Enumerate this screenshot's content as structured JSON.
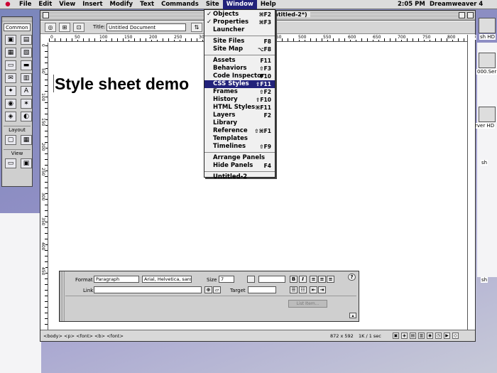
{
  "menubar": {
    "items": [
      "File",
      "Edit",
      "View",
      "Insert",
      "Modify",
      "Text",
      "Commands",
      "Site",
      "Window",
      "Help"
    ],
    "active": "Window",
    "clock": "2:05 PM",
    "app_name": "Dreamweaver 4"
  },
  "desktop": {
    "labels": [
      "000.Ser",
      "sh HD",
      "rver HD",
      "sh",
      "sh"
    ]
  },
  "objects_panel": {
    "select_value": "Common",
    "section_layout": "Layout",
    "section_view": "View"
  },
  "document": {
    "window_title_fragment": "ntitled-2*)",
    "title_label": "Title:",
    "title_value": "Untitled Document",
    "heading": "Style sheet demo",
    "ruler_numbers": [
      "0",
      "50",
      "100",
      "150",
      "200",
      "250",
      "300",
      "350",
      "400",
      "450",
      "500",
      "550",
      "600",
      "650",
      "700",
      "750",
      "800",
      "850"
    ],
    "vruler_numbers": [
      "0",
      "50",
      "100",
      "150",
      "200",
      "250",
      "300",
      "350",
      "400",
      "450"
    ],
    "status_tags": "<body> <p> <font> <b> <font>",
    "status_size": "872 x 592",
    "status_download": "1K / 1 sec"
  },
  "properties": {
    "format_label": "Format",
    "format_value": "Paragraph",
    "font_value": "Arial, Helvetica, sans",
    "size_label": "Size",
    "size_value": "7",
    "link_label": "Link",
    "target_label": "Target",
    "list_item_label": "List Item..."
  },
  "window_menu": {
    "groups": [
      [
        {
          "label": "Objects",
          "shortcut": "⌘F2",
          "checked": true
        },
        {
          "label": "Properties",
          "shortcut": "⌘F3",
          "checked": true
        },
        {
          "label": "Launcher",
          "shortcut": "",
          "checked": false
        }
      ],
      [
        {
          "label": "Site Files",
          "shortcut": "F8",
          "checked": false
        },
        {
          "label": "Site Map",
          "shortcut": "⌥F8",
          "checked": false
        }
      ],
      [
        {
          "label": "Assets",
          "shortcut": "F11",
          "checked": false
        },
        {
          "label": "Behaviors",
          "shortcut": "⇧F3",
          "checked": false
        },
        {
          "label": "Code Inspector",
          "shortcut": "F10",
          "checked": false
        },
        {
          "label": "CSS Styles",
          "shortcut": "⇧F11",
          "checked": false,
          "highlighted": true
        },
        {
          "label": "Frames",
          "shortcut": "⇧F2",
          "checked": false
        },
        {
          "label": "History",
          "shortcut": "⇧F10",
          "checked": false
        },
        {
          "label": "HTML Styles",
          "shortcut": "⌘F11",
          "checked": false
        },
        {
          "label": "Layers",
          "shortcut": "F2",
          "checked": false
        },
        {
          "label": "Library",
          "shortcut": "",
          "checked": false
        },
        {
          "label": "Reference",
          "shortcut": "⇧⌘F1",
          "checked": false
        },
        {
          "label": "Templates",
          "shortcut": "",
          "checked": false
        },
        {
          "label": "Timelines",
          "shortcut": "⇧F9",
          "checked": false
        }
      ],
      [
        {
          "label": "Arrange Panels",
          "shortcut": "",
          "checked": false
        },
        {
          "label": "Hide Panels",
          "shortcut": "F4",
          "checked": false
        }
      ],
      [
        {
          "label": "Untitled-2",
          "shortcut": "",
          "checked": false
        }
      ]
    ]
  }
}
